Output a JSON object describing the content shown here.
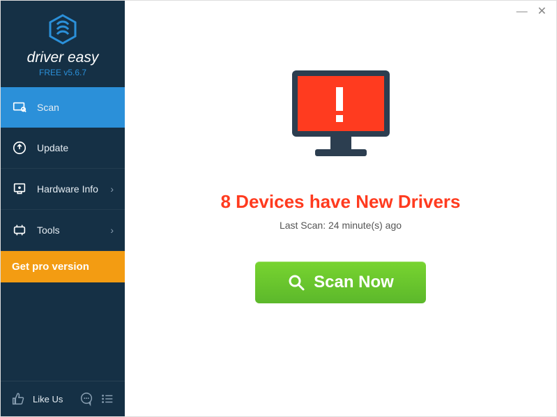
{
  "brand": {
    "name": "driver easy",
    "version": "FREE v5.6.7"
  },
  "sidebar": {
    "items": [
      {
        "label": "Scan"
      },
      {
        "label": "Update"
      },
      {
        "label": "Hardware Info"
      },
      {
        "label": "Tools"
      }
    ],
    "pro_label": "Get pro version",
    "like_label": "Like Us"
  },
  "main": {
    "headline": "8 Devices have New Drivers",
    "subline": "Last Scan: 24 minute(s) ago",
    "scan_button": "Scan Now"
  },
  "colors": {
    "sidebar_bg": "#153045",
    "accent": "#2b90d9",
    "pro": "#f39c12",
    "alert_red": "#ff3b1f",
    "scan_green": "#5cb82b"
  }
}
